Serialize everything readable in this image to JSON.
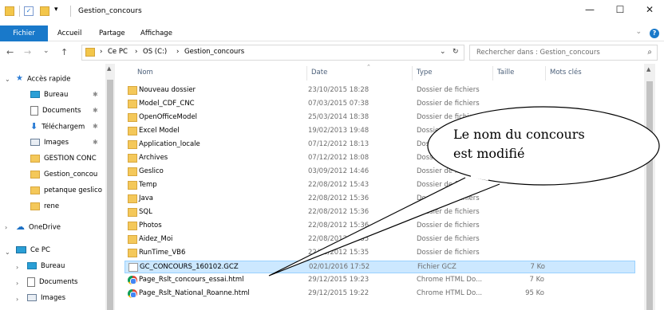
{
  "titlebar": {
    "title": "Gestion_concours",
    "dropdown_glyph": "▾",
    "buttons": {
      "minimize": "—",
      "maximize": "☐",
      "close": "✕"
    }
  },
  "ribbon": {
    "tabs": [
      "Fichier",
      "Accueil",
      "Partage",
      "Affichage"
    ],
    "help": "?",
    "expand_glyph": "⌄"
  },
  "address": {
    "crumbs": [
      "Ce PC",
      "OS (C:)",
      "Gestion_concours"
    ],
    "separator": "›",
    "back": "←",
    "forward": "→",
    "recent": "⌄",
    "up": "↑",
    "dropdown": "⌄",
    "refresh": "↻"
  },
  "search": {
    "placeholder": "Rechercher dans : Gestion_concours",
    "icon": "⌕"
  },
  "nav": {
    "items": [
      {
        "label": "Accès rapide",
        "icon": "star-icon"
      },
      {
        "label": "Bureau",
        "icon": "desktop-icon"
      },
      {
        "label": "Documents",
        "icon": "documents-icon"
      },
      {
        "label": "Téléchargem",
        "icon": "download-icon"
      },
      {
        "label": "Images",
        "icon": "images-icon"
      },
      {
        "label": "GESTION CONC",
        "icon": "folder-icon"
      },
      {
        "label": "Gestion_concou",
        "icon": "folder-icon"
      },
      {
        "label": "petanque geslico",
        "icon": "folder-icon"
      },
      {
        "label": "rene",
        "icon": "folder-icon"
      },
      {
        "label": "OneDrive",
        "icon": "cloud-icon"
      },
      {
        "label": "Ce PC",
        "icon": "pc-icon"
      },
      {
        "label": "Bureau",
        "icon": "desktop-icon"
      },
      {
        "label": "Documents",
        "icon": "documents-icon"
      },
      {
        "label": "Images",
        "icon": "images-icon"
      }
    ],
    "pin_glyph": "✱",
    "expanded_glyph": "⌄",
    "collapsed_glyph": "›"
  },
  "columns": {
    "name": "Nom",
    "date": "Date",
    "type": "Type",
    "size": "Taille",
    "tags": "Mots clés",
    "sort_glyph": "⌃"
  },
  "files": [
    {
      "name": "Nouveau dossier",
      "date": "23/10/2015 18:28",
      "type": "Dossier de fichiers",
      "size": "",
      "kind": "folder"
    },
    {
      "name": "Model_CDF_CNC",
      "date": "07/03/2015 07:38",
      "type": "Dossier de fichiers",
      "size": "",
      "kind": "folder"
    },
    {
      "name": "OpenOfficeModel",
      "date": "25/03/2014 18:38",
      "type": "Dossier de fichiers",
      "size": "",
      "kind": "folder"
    },
    {
      "name": "Excel Model",
      "date": "19/02/2013 19:48",
      "type": "Dossier de fichiers",
      "size": "",
      "kind": "folder"
    },
    {
      "name": "Application_locale",
      "date": "07/12/2012 18:13",
      "type": "Dossier de fichiers",
      "size": "",
      "kind": "folder"
    },
    {
      "name": "Archives",
      "date": "07/12/2012 18:08",
      "type": "Dossier de fichiers",
      "size": "",
      "kind": "folder"
    },
    {
      "name": "Geslico",
      "date": "03/09/2012 14:46",
      "type": "Dossier de fichiers",
      "size": "",
      "kind": "folder"
    },
    {
      "name": "Temp",
      "date": "22/08/2012 15:43",
      "type": "Dossier de fichiers",
      "size": "",
      "kind": "folder"
    },
    {
      "name": "Java",
      "date": "22/08/2012 15:36",
      "type": "Dossier de fichiers",
      "size": "",
      "kind": "folder"
    },
    {
      "name": "SQL",
      "date": "22/08/2012 15:36",
      "type": "Dossier de fichiers",
      "size": "",
      "kind": "folder"
    },
    {
      "name": "Photos",
      "date": "22/08/2012 15:36",
      "type": "Dossier de fichiers",
      "size": "",
      "kind": "folder"
    },
    {
      "name": "Aidez_Moi",
      "date": "22/08/2012 15:35",
      "type": "Dossier de fichiers",
      "size": "",
      "kind": "folder"
    },
    {
      "name": "RunTime_VB6",
      "date": "22/08/2012 15:35",
      "type": "Dossier de fichiers",
      "size": "",
      "kind": "folder"
    },
    {
      "name": "GC_CONCOURS_160102.GCZ",
      "date": "02/01/2016 17:52",
      "type": "Fichier GCZ",
      "size": "7 Ko",
      "kind": "file",
      "selected": true
    },
    {
      "name": "Page_Rslt_concours_essai.html",
      "date": "29/12/2015 19:23",
      "type": "Chrome HTML Do...",
      "size": "7 Ko",
      "kind": "chrome"
    },
    {
      "name": "Page_Rslt_National_Roanne.html",
      "date": "29/12/2015 19:22",
      "type": "Chrome HTML Do...",
      "size": "95 Ko",
      "kind": "chrome"
    }
  ],
  "callout": {
    "line1": "Le nom du concours",
    "line2": "est modifié"
  }
}
